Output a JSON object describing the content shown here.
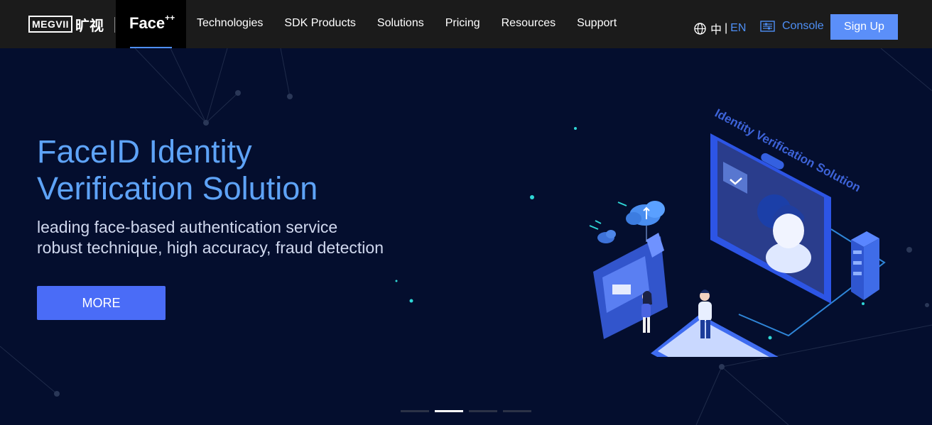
{
  "brand": {
    "logo_box": "MEGVII",
    "logo_cn": "旷视",
    "product": "Face",
    "product_sup": "++"
  },
  "nav": {
    "items": [
      "Technologies",
      "SDK Products",
      "Solutions",
      "Pricing",
      "Resources",
      "Support"
    ]
  },
  "lang": {
    "cn": "中",
    "separator": "|",
    "en": "EN"
  },
  "console": {
    "label": "Console"
  },
  "signup": {
    "label": "Sign Up"
  },
  "hero": {
    "title_line1": "FaceID Identity",
    "title_line2": "Verification Solution",
    "subtitle_line1": "leading face-based authentication service",
    "subtitle_line2": "robust technique, high accuracy, fraud detection",
    "more_label": "MORE",
    "illustration_caption": "Identity Verification Solution"
  },
  "carousel": {
    "count": 4,
    "active": 1
  },
  "colors": {
    "accent": "#4e8ff5",
    "title": "#5ea3f7",
    "button": "#4a6cf7",
    "nav_bg": "#1b1b1b",
    "hero_bg": "#040e2e"
  },
  "icons": {
    "lang": "globe-icon",
    "console": "console-icon"
  }
}
